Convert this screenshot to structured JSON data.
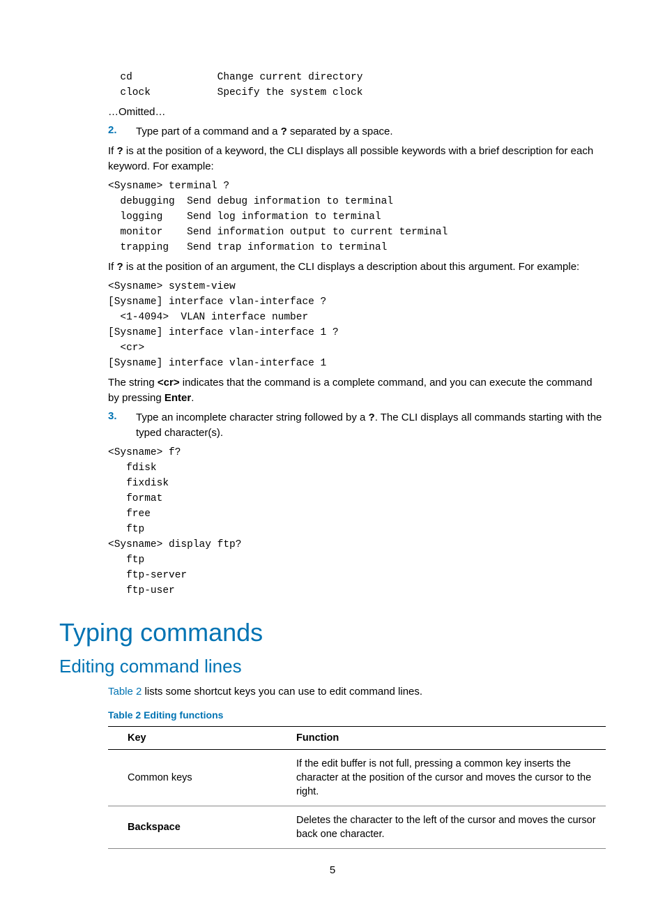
{
  "code1": "  cd              Change current directory\n  clock           Specify the system clock",
  "omitted": "…Omitted…",
  "step2_num": "2.",
  "step2_a": "Type part of a command and a ",
  "step2_b": "?",
  "step2_c": " separated by a space.",
  "p_if1_a": "If ",
  "p_if1_b": "?",
  "p_if1_c": " is at the position of a keyword, the CLI displays all possible keywords with a brief description for each keyword. For example:",
  "code2": "<Sysname> terminal ?\n  debugging  Send debug information to terminal\n  logging    Send log information to terminal\n  monitor    Send information output to current terminal\n  trapping   Send trap information to terminal",
  "p_if2_a": "If ",
  "p_if2_b": "?",
  "p_if2_c": " is at the position of an argument, the CLI displays a description about this argument. For example:",
  "code3": "<Sysname> system-view\n[Sysname] interface vlan-interface ?\n  <1-4094>  VLAN interface number\n[Sysname] interface vlan-interface 1 ?\n  <cr>\n[Sysname] interface vlan-interface 1",
  "p_cr_a": "The string ",
  "p_cr_b": "<cr>",
  "p_cr_c": " indicates that the command is a complete command, and you can execute the command by pressing ",
  "p_cr_d": "Enter",
  "p_cr_e": ".",
  "step3_num": "3.",
  "step3_a": "Type an incomplete character string followed by a ",
  "step3_b": "?",
  "step3_c": ". The CLI displays all commands starting with the typed character(s).",
  "code4": "<Sysname> f?\n   fdisk\n   fixdisk\n   format\n   free\n   ftp\n<Sysname> display ftp?\n   ftp\n   ftp-server\n   ftp-user",
  "h1": "Typing commands",
  "h2": "Editing command lines",
  "p_table_a": "Table 2",
  "p_table_b": " lists some shortcut keys you can use to edit command lines.",
  "table_caption": "Table 2 Editing functions",
  "th_key": "Key",
  "th_func": "Function",
  "row1_key": "Common keys",
  "row1_func": "If the edit buffer is not full, pressing a common key inserts the character at the position of the cursor and moves the cursor to the right.",
  "row2_key": "Backspace",
  "row2_func": "Deletes the character to the left of the cursor and moves the cursor back one character.",
  "page_number": "5"
}
